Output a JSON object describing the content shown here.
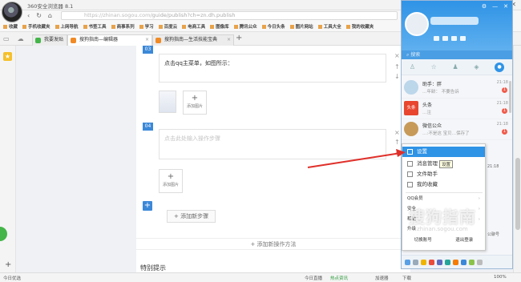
{
  "window": {
    "title": "360安全浏览器 8.1",
    "buttons": [
      "▾",
      "—",
      "▫",
      "✕"
    ]
  },
  "url": {
    "host": "https://zhinan.sogou.com",
    "path": "/guide/publish?ch=zn.dh.publish"
  },
  "bookmarks": [
    "收藏",
    "手机收藏夹",
    "上网导航",
    "书签工具",
    "商事系列",
    "学习",
    "百度云",
    "电商工具",
    "图像库",
    "腾讯公众",
    "今日头条",
    "图片网站",
    "工具大全",
    "我的收藏夹"
  ],
  "tabs": [
    {
      "label": "我要发贴",
      "color": "#44b549"
    },
    {
      "label": "搜狗指南—编辑器",
      "color": "#f08a24"
    },
    {
      "label": "搜狗指南—生活技能宝典",
      "color": "#f08a24"
    }
  ],
  "editor": {
    "step3_num": "03",
    "step3_text": "点击qq主菜单，如图所示：",
    "add_image": "添加图片",
    "step4_num": "04",
    "step4_placeholder": "点击此处输入操作步骤",
    "add_step": "+ 添加新步骤",
    "add_method": "+ 添加新操作方法",
    "special_tip": "特别提示"
  },
  "qq": {
    "search_placeholder": "搜索",
    "items": [
      {
        "name": "助手：胖",
        "msg": "…年龄：  不要告诉",
        "time": "21:18",
        "badge": "1"
      },
      {
        "name": "头条",
        "msg": "…注",
        "time": "21:18",
        "badge": "1"
      },
      {
        "name": "微信公众",
        "msg": "…:不是这  宝贝…保存了",
        "time": "21:18",
        "badge": "1"
      }
    ],
    "menu": {
      "settings": "设置",
      "message_manager": "消息管理",
      "file_helper": "文件助手",
      "my_favorites": "我的收藏",
      "qq_member": "QQ会员",
      "security": "安全",
      "help": "帮助",
      "upgrade": "升级",
      "switch_account": "切换账号",
      "logout": "退出登录",
      "tooltip": "设置"
    },
    "right_labels": [
      "21:18",
      "公聊号"
    ]
  },
  "watermark": {
    "text": "搜狗指南",
    "url": "zhinan.sogou.com"
  },
  "status": {
    "left": "今日优选",
    "items": [
      "今日直播",
      "热点资讯",
      "加速器",
      "下载",
      "100%"
    ]
  }
}
